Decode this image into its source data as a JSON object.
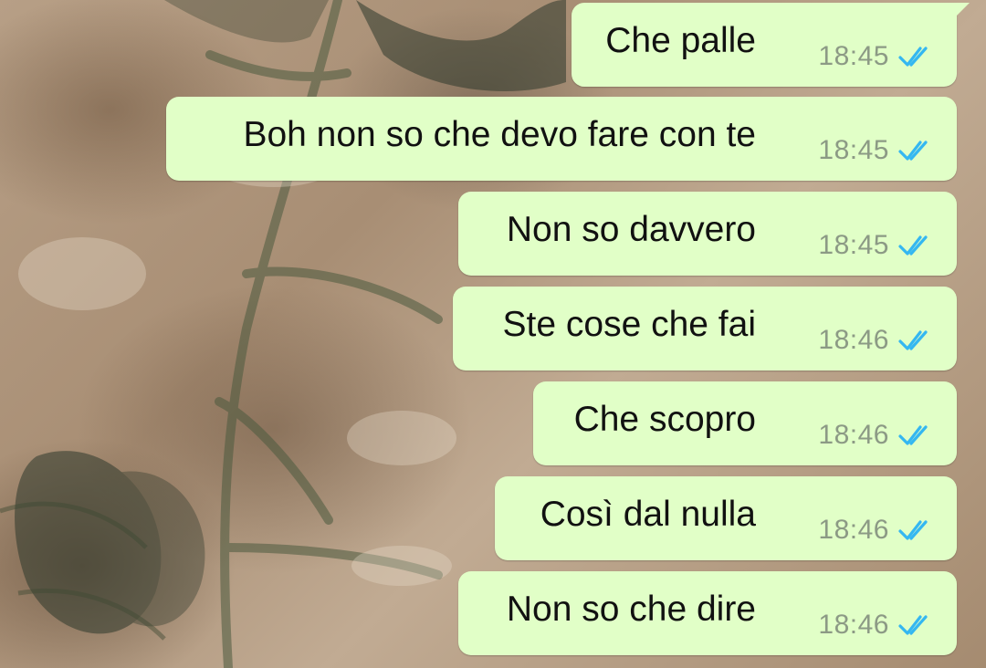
{
  "colors": {
    "bubble_outgoing": "#e1ffc7",
    "tick_read": "#34b7f1",
    "timestamp": "#8c9a85",
    "message_text": "#111111"
  },
  "messages": [
    {
      "text": "Che palle",
      "time": "18:45",
      "status_icon": "double-check-read-icon"
    },
    {
      "text": "Boh non so che devo fare con te",
      "time": "18:45",
      "status_icon": "double-check-read-icon"
    },
    {
      "text": "Non so davvero",
      "time": "18:45",
      "status_icon": "double-check-read-icon"
    },
    {
      "text": "Ste cose che fai",
      "time": "18:46",
      "status_icon": "double-check-read-icon"
    },
    {
      "text": "Che scopro",
      "time": "18:46",
      "status_icon": "double-check-read-icon"
    },
    {
      "text": "Così dal nulla",
      "time": "18:46",
      "status_icon": "double-check-read-icon"
    },
    {
      "text": "Non so che dire",
      "time": "18:46",
      "status_icon": "double-check-read-icon"
    }
  ]
}
